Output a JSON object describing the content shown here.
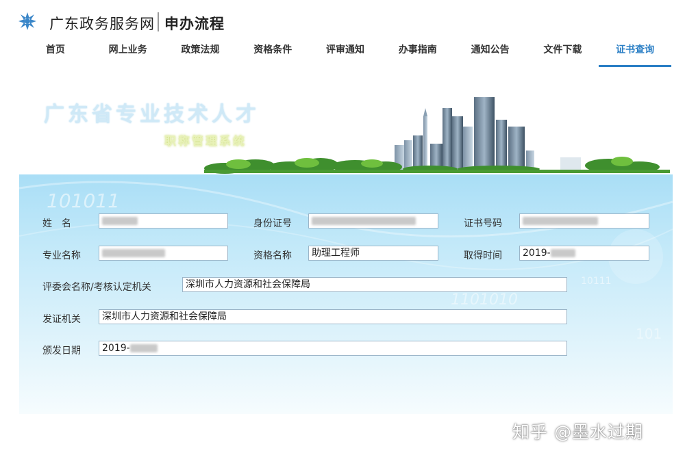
{
  "header": {
    "site_title": "广东政务服务网",
    "page_subtitle": "申办流程",
    "logo_icon": "star-snowflake-logo",
    "brand_color": "#2b7fc5"
  },
  "nav": {
    "items": [
      {
        "label": "首页"
      },
      {
        "label": "网上业务"
      },
      {
        "label": "政策法规"
      },
      {
        "label": "资格条件"
      },
      {
        "label": "评审通知"
      },
      {
        "label": "办事指南"
      },
      {
        "label": "通知公告"
      },
      {
        "label": "文件下载"
      },
      {
        "label": "证书查询"
      }
    ],
    "active": "证书查询"
  },
  "banner": {
    "title": "广东省专业技术人才",
    "subtitle": "职称管理系统"
  },
  "form": {
    "name_label": "姓　名",
    "id_label": "身份证号",
    "cert_no_label": "证书号码",
    "major_label": "专业名称",
    "qual_label": "资格名称",
    "qual_value": "助理工程师",
    "obtain_label": "取得时间",
    "obtain_value": "2019-",
    "committee_label": "评委会名称/考核认定机关",
    "committee_value": "深圳市人力资源和社会保障局",
    "issuer_label": "发证机关",
    "issuer_value": "深圳市人力资源和社会保障局",
    "issue_date_label": "颁发日期",
    "issue_date_value": "2019-"
  },
  "watermark": "知乎 @墨水过期"
}
